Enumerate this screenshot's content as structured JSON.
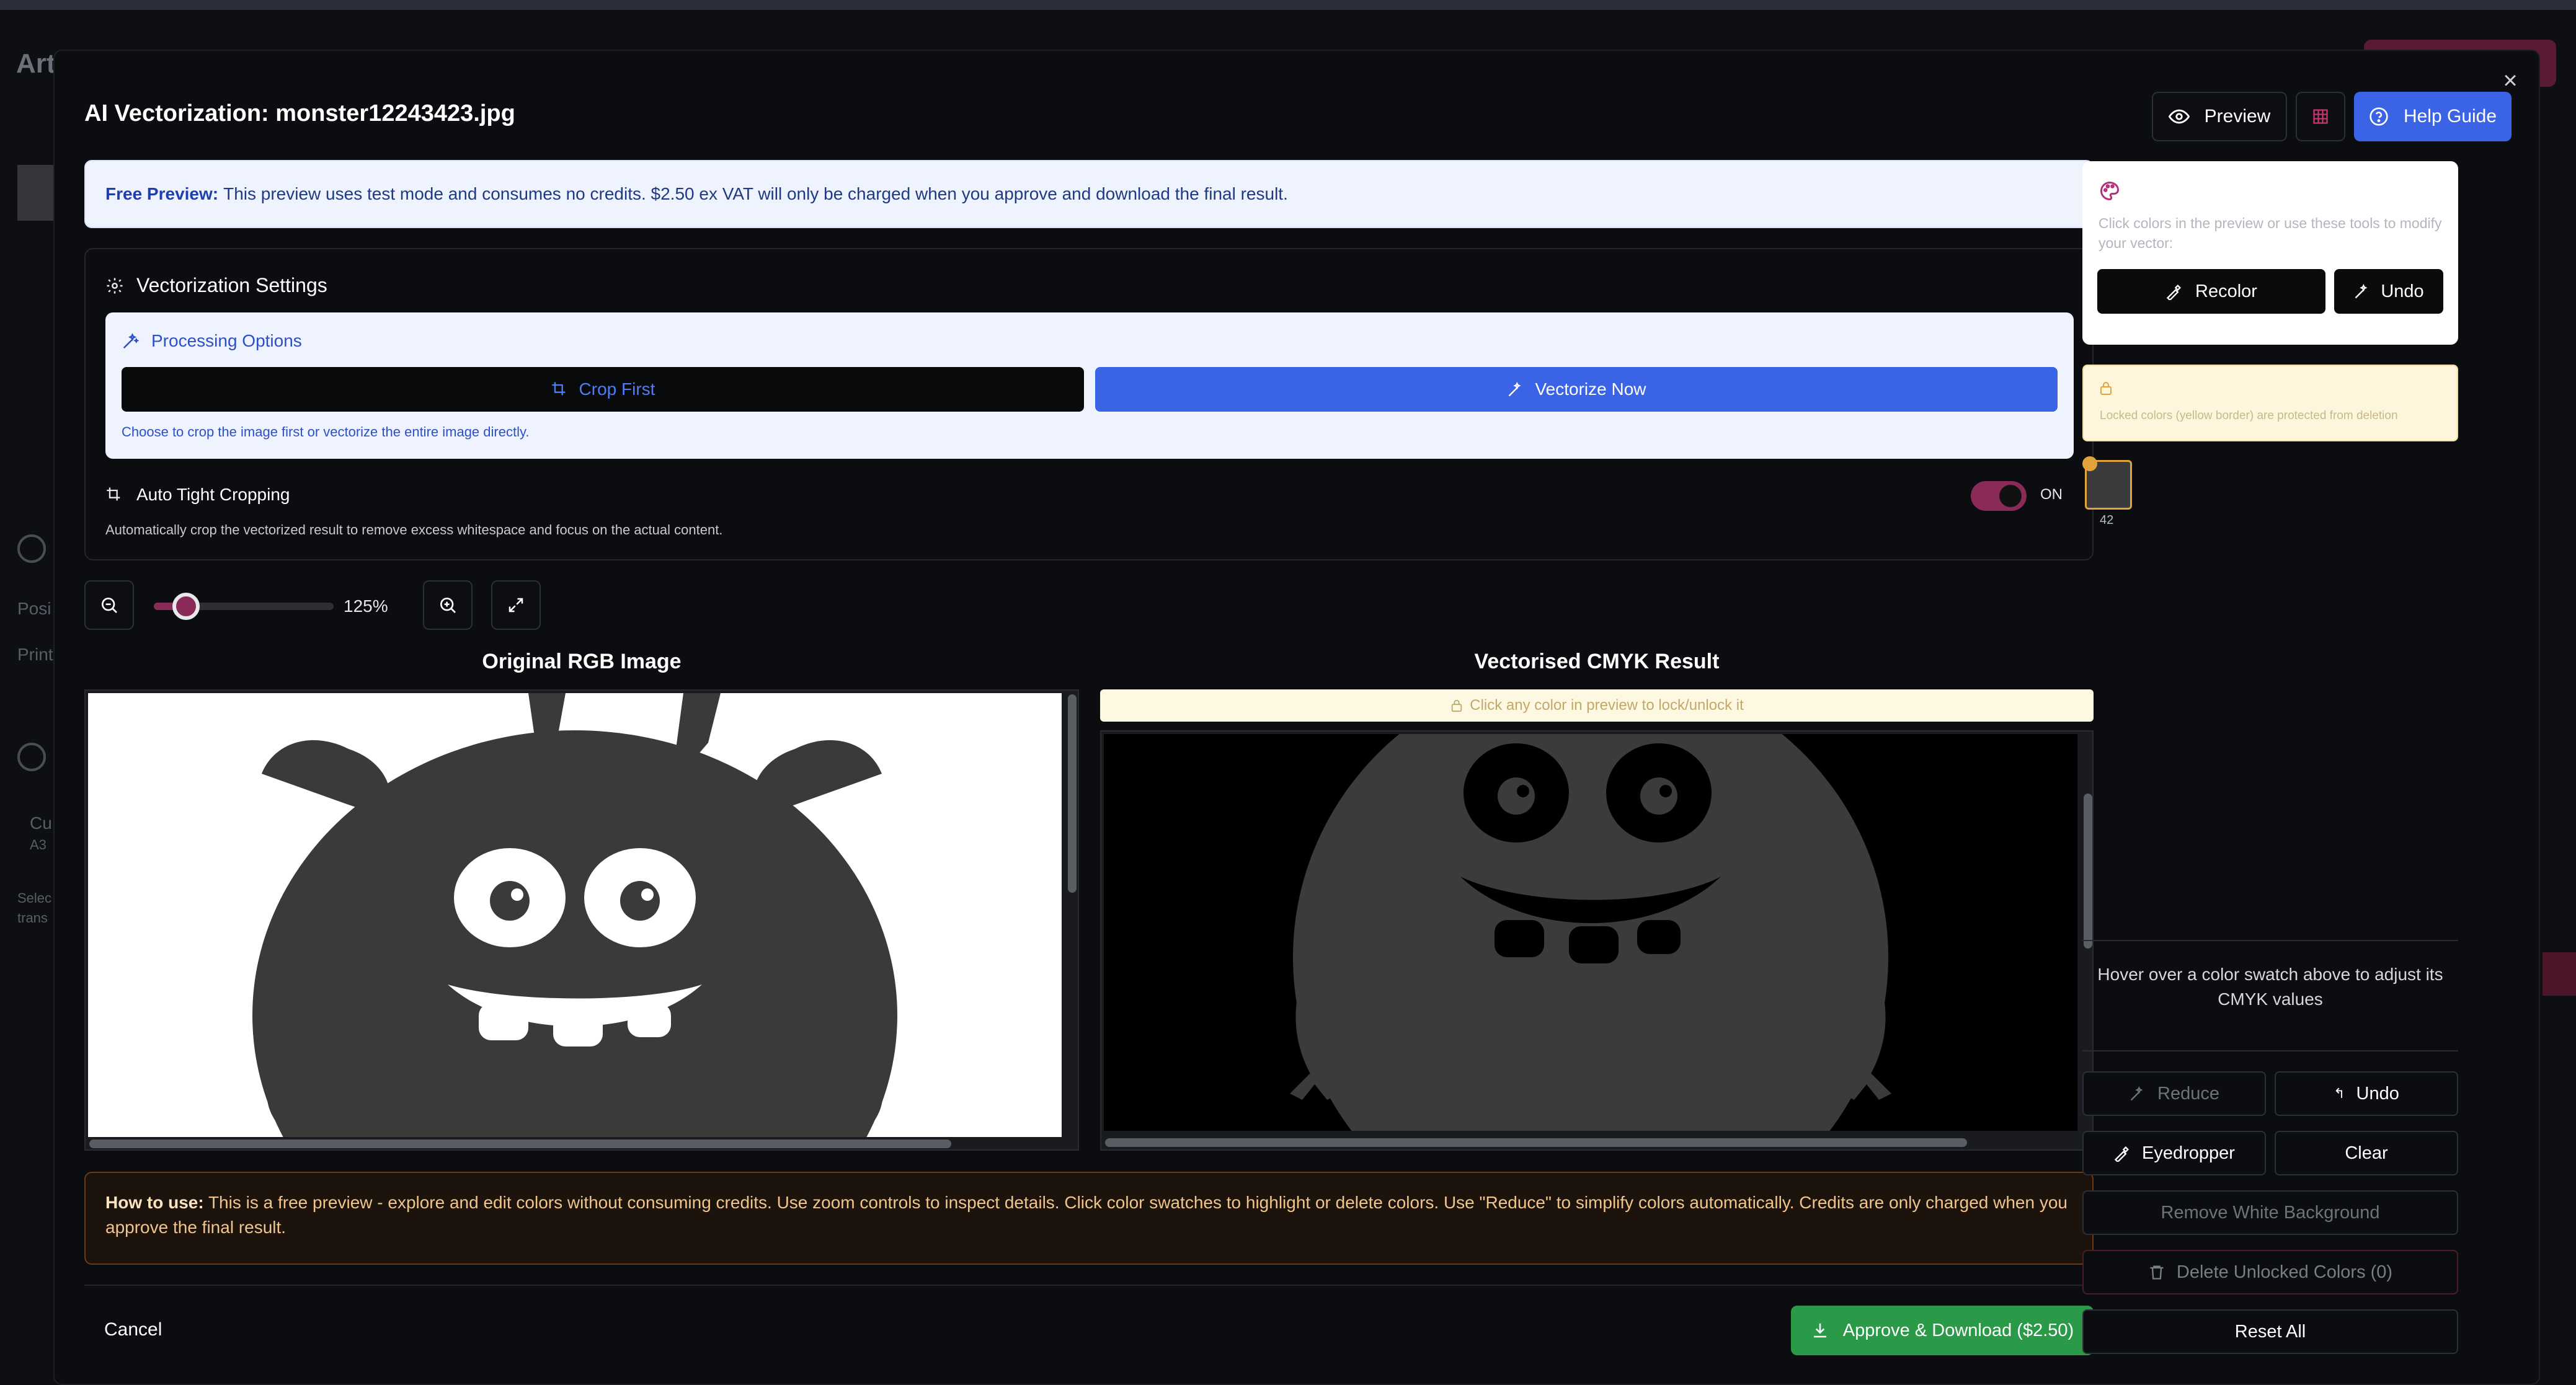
{
  "background": {
    "title": "Art",
    "side_labels": [
      "Posi",
      "Print"
    ],
    "panel_lines": [
      "Cu",
      "A3",
      "Selec",
      "trans"
    ]
  },
  "modal": {
    "title": "AI Vectorization: monster12243423.jpg",
    "close_label": "×",
    "header_buttons": {
      "preview_label": "Preview",
      "help_label": "Help Guide"
    },
    "banner": {
      "bold": "Free Preview:",
      "text": "This preview uses test mode and consumes no credits. $2.50 ex VAT will only be charged when you approve and download the final result."
    },
    "settings": {
      "title": "Vectorization Settings",
      "processing_title": "Processing Options",
      "crop_label": "Crop First",
      "vectorize_label": "Vectorize Now",
      "processing_hint": "Choose to crop the image first or vectorize the entire image directly.",
      "auto_crop_title": "Auto Tight Cropping",
      "auto_crop_desc": "Automatically crop the vectorized result to remove excess whitespace and focus on the actual content.",
      "auto_crop_state": "ON",
      "auto_crop_enabled": true
    },
    "zoom": {
      "value_label": "125%",
      "level_fraction": 0.1
    },
    "left_panel_title": "Original RGB Image",
    "right_panel_title": "Vectorised CMYK Result",
    "right_hint": "Click any color in preview to lock/unlock it",
    "howto": {
      "bold": "How to use:",
      "text": "This is a free preview - explore and edit colors without consuming credits. Use zoom controls to inspect details. Click color swatches to highlight or delete colors. Use \"Reduce\" to simplify colors automatically. Credits are only charged when you approve the final result."
    },
    "cancel_label": "Cancel",
    "approve_label": "Approve & Download ($2.50)"
  },
  "sidebar": {
    "tools_title": "Color Tools",
    "tools_desc": "Click colors in the preview or use these tools to modify your vector:",
    "recolor_label": "Recolor",
    "undo_label": "Undo",
    "locked_text": "Locked colors (yellow border) are protected from deletion",
    "swatch_count": "42",
    "swatch_color": "#3b3b3d",
    "hover_note": "Hover over a color swatch above to adjust its CMYK values",
    "reduce_label": "Reduce",
    "undo2_label": "Undo",
    "eyedropper_label": "Eyedropper",
    "clear_label": "Clear",
    "remove_bg_label": "Remove White Background",
    "delete_unlocked_label": "Delete Unlocked Colors (0)",
    "reset_label": "Reset All"
  },
  "colors": {
    "accent_blue": "#3b63e6",
    "accent_magenta": "#8a2a58",
    "approve_green": "#2b9a48",
    "monster_original": "#3a3a3a",
    "monster_vector": "#3b3b3d"
  }
}
